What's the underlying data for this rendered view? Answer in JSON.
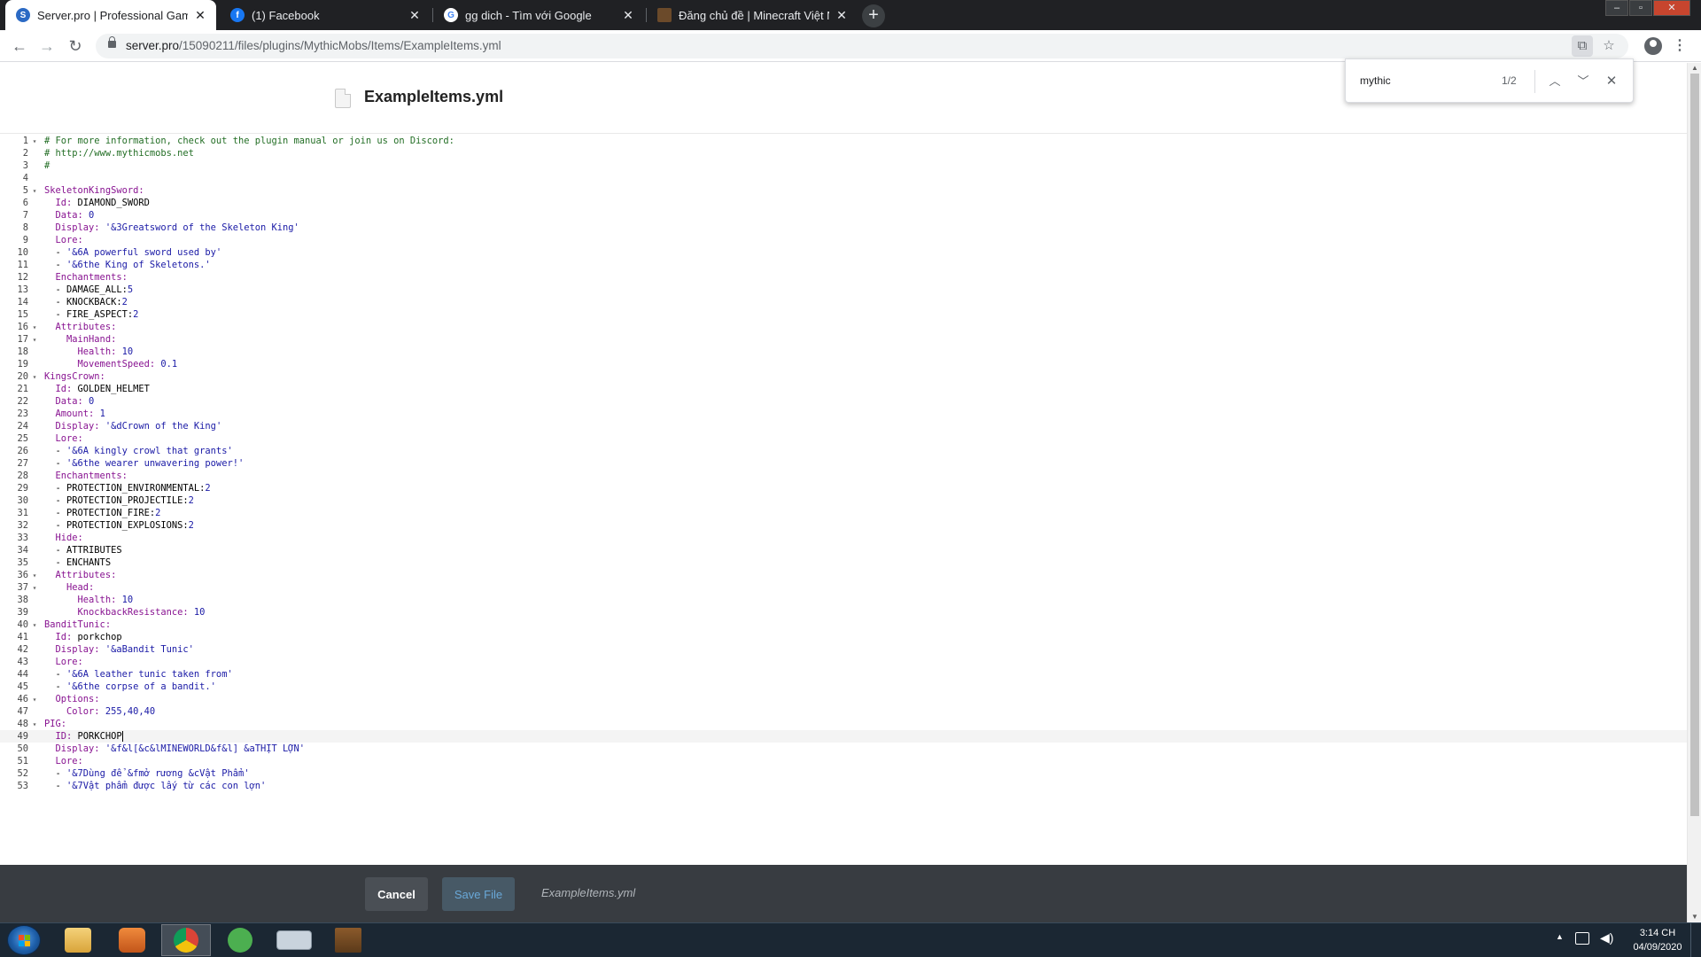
{
  "browser": {
    "tabs": [
      {
        "title": "Server.pro | Professional Game Se",
        "active": true,
        "favicon": "serverpro-icon"
      },
      {
        "title": "(1) Facebook",
        "active": false,
        "favicon": "facebook-icon"
      },
      {
        "title": "gg dich - Tìm với Google",
        "active": false,
        "favicon": "google-icon"
      },
      {
        "title": "Đăng chủ đề | Minecraft Việt Nam",
        "active": false,
        "favicon": "minecraft-icon"
      }
    ],
    "close_glyph": "✕",
    "new_tab_glyph": "+",
    "url_host": "server.pro",
    "url_path": "/15090211/files/plugins/MythicMobs/Items/ExampleItems.yml",
    "window_controls": [
      "–",
      "▫",
      "✕"
    ]
  },
  "find_bar": {
    "query": "mythic",
    "count": "1/2"
  },
  "file": {
    "title": "ExampleItems.yml"
  },
  "editor": {
    "current_line": 49,
    "lines": [
      {
        "n": "1",
        "fold": true,
        "parts": [
          {
            "t": "com",
            "s": "# For more information, check out the plugin manual or join us on Discord:"
          }
        ]
      },
      {
        "n": "2",
        "fold": false,
        "parts": [
          {
            "t": "com",
            "s": "# http://www.mythicmobs.net"
          }
        ]
      },
      {
        "n": "3",
        "fold": false,
        "parts": [
          {
            "t": "com",
            "s": "#"
          }
        ]
      },
      {
        "n": "4",
        "fold": false,
        "parts": []
      },
      {
        "n": "5",
        "fold": true,
        "parts": [
          {
            "t": "key",
            "s": "SkeletonKingSword:"
          }
        ]
      },
      {
        "n": "6",
        "fold": false,
        "parts": [
          {
            "t": "key",
            "s": "  Id: "
          },
          {
            "t": "plain",
            "s": "DIAMOND_SWORD"
          }
        ]
      },
      {
        "n": "7",
        "fold": false,
        "parts": [
          {
            "t": "key",
            "s": "  Data: "
          },
          {
            "t": "num",
            "s": "0"
          }
        ]
      },
      {
        "n": "8",
        "fold": false,
        "parts": [
          {
            "t": "key",
            "s": "  Display: "
          },
          {
            "t": "str",
            "s": "'&3Greatsword of the Skeleton King'"
          }
        ]
      },
      {
        "n": "9",
        "fold": false,
        "parts": [
          {
            "t": "key",
            "s": "  Lore:"
          }
        ]
      },
      {
        "n": "10",
        "fold": false,
        "parts": [
          {
            "t": "plain",
            "s": "  - "
          },
          {
            "t": "str",
            "s": "'&6A powerful sword used by'"
          }
        ]
      },
      {
        "n": "11",
        "fold": false,
        "parts": [
          {
            "t": "plain",
            "s": "  - "
          },
          {
            "t": "str",
            "s": "'&6the King of Skeletons.'"
          }
        ]
      },
      {
        "n": "12",
        "fold": false,
        "parts": [
          {
            "t": "key",
            "s": "  Enchantments:"
          }
        ]
      },
      {
        "n": "13",
        "fold": false,
        "parts": [
          {
            "t": "plain",
            "s": "  - DAMAGE_ALL:"
          },
          {
            "t": "num",
            "s": "5"
          }
        ]
      },
      {
        "n": "14",
        "fold": false,
        "parts": [
          {
            "t": "plain",
            "s": "  - KNOCKBACK:"
          },
          {
            "t": "num",
            "s": "2"
          }
        ]
      },
      {
        "n": "15",
        "fold": false,
        "parts": [
          {
            "t": "plain",
            "s": "  - FIRE_ASPECT:"
          },
          {
            "t": "num",
            "s": "2"
          }
        ]
      },
      {
        "n": "16",
        "fold": true,
        "parts": [
          {
            "t": "key",
            "s": "  Attributes:"
          }
        ]
      },
      {
        "n": "17",
        "fold": true,
        "parts": [
          {
            "t": "key",
            "s": "    MainHand:"
          }
        ]
      },
      {
        "n": "18",
        "fold": false,
        "parts": [
          {
            "t": "key",
            "s": "      Health: "
          },
          {
            "t": "num",
            "s": "10"
          }
        ]
      },
      {
        "n": "19",
        "fold": false,
        "parts": [
          {
            "t": "key",
            "s": "      MovementSpeed: "
          },
          {
            "t": "num",
            "s": "0.1"
          }
        ]
      },
      {
        "n": "20",
        "fold": true,
        "parts": [
          {
            "t": "key",
            "s": "KingsCrown:"
          }
        ]
      },
      {
        "n": "21",
        "fold": false,
        "parts": [
          {
            "t": "key",
            "s": "  Id: "
          },
          {
            "t": "plain",
            "s": "GOLDEN_HELMET"
          }
        ]
      },
      {
        "n": "22",
        "fold": false,
        "parts": [
          {
            "t": "key",
            "s": "  Data: "
          },
          {
            "t": "num",
            "s": "0"
          }
        ]
      },
      {
        "n": "23",
        "fold": false,
        "parts": [
          {
            "t": "key",
            "s": "  Amount: "
          },
          {
            "t": "num",
            "s": "1"
          }
        ]
      },
      {
        "n": "24",
        "fold": false,
        "parts": [
          {
            "t": "key",
            "s": "  Display: "
          },
          {
            "t": "str",
            "s": "'&dCrown of the King'"
          }
        ]
      },
      {
        "n": "25",
        "fold": false,
        "parts": [
          {
            "t": "key",
            "s": "  Lore:"
          }
        ]
      },
      {
        "n": "26",
        "fold": false,
        "parts": [
          {
            "t": "plain",
            "s": "  - "
          },
          {
            "t": "str",
            "s": "'&6A kingly crowl that grants'"
          }
        ]
      },
      {
        "n": "27",
        "fold": false,
        "parts": [
          {
            "t": "plain",
            "s": "  - "
          },
          {
            "t": "str",
            "s": "'&6the wearer unwavering power!'"
          }
        ]
      },
      {
        "n": "28",
        "fold": false,
        "parts": [
          {
            "t": "key",
            "s": "  Enchantments:"
          }
        ]
      },
      {
        "n": "29",
        "fold": false,
        "parts": [
          {
            "t": "plain",
            "s": "  - PROTECTION_ENVIRONMENTAL:"
          },
          {
            "t": "num",
            "s": "2"
          }
        ]
      },
      {
        "n": "30",
        "fold": false,
        "parts": [
          {
            "t": "plain",
            "s": "  - PROTECTION_PROJECTILE:"
          },
          {
            "t": "num",
            "s": "2"
          }
        ]
      },
      {
        "n": "31",
        "fold": false,
        "parts": [
          {
            "t": "plain",
            "s": "  - PROTECTION_FIRE:"
          },
          {
            "t": "num",
            "s": "2"
          }
        ]
      },
      {
        "n": "32",
        "fold": false,
        "parts": [
          {
            "t": "plain",
            "s": "  - PROTECTION_EXPLOSIONS:"
          },
          {
            "t": "num",
            "s": "2"
          }
        ]
      },
      {
        "n": "33",
        "fold": false,
        "parts": [
          {
            "t": "key",
            "s": "  Hide:"
          }
        ]
      },
      {
        "n": "34",
        "fold": false,
        "parts": [
          {
            "t": "plain",
            "s": "  - ATTRIBUTES"
          }
        ]
      },
      {
        "n": "35",
        "fold": false,
        "parts": [
          {
            "t": "plain",
            "s": "  - ENCHANTS"
          }
        ]
      },
      {
        "n": "36",
        "fold": true,
        "parts": [
          {
            "t": "key",
            "s": "  Attributes:"
          }
        ]
      },
      {
        "n": "37",
        "fold": true,
        "parts": [
          {
            "t": "key",
            "s": "    Head:"
          }
        ]
      },
      {
        "n": "38",
        "fold": false,
        "parts": [
          {
            "t": "key",
            "s": "      Health: "
          },
          {
            "t": "num",
            "s": "10"
          }
        ]
      },
      {
        "n": "39",
        "fold": false,
        "parts": [
          {
            "t": "key",
            "s": "      KnockbackResistance: "
          },
          {
            "t": "num",
            "s": "10"
          }
        ]
      },
      {
        "n": "40",
        "fold": true,
        "parts": [
          {
            "t": "key",
            "s": "BanditTunic:"
          }
        ]
      },
      {
        "n": "41",
        "fold": false,
        "parts": [
          {
            "t": "key",
            "s": "  Id: "
          },
          {
            "t": "plain",
            "s": "porkchop"
          }
        ]
      },
      {
        "n": "42",
        "fold": false,
        "parts": [
          {
            "t": "key",
            "s": "  Display: "
          },
          {
            "t": "str",
            "s": "'&aBandit Tunic'"
          }
        ]
      },
      {
        "n": "43",
        "fold": false,
        "parts": [
          {
            "t": "key",
            "s": "  Lore:"
          }
        ]
      },
      {
        "n": "44",
        "fold": false,
        "parts": [
          {
            "t": "plain",
            "s": "  - "
          },
          {
            "t": "str",
            "s": "'&6A leather tunic taken from'"
          }
        ]
      },
      {
        "n": "45",
        "fold": false,
        "parts": [
          {
            "t": "plain",
            "s": "  - "
          },
          {
            "t": "str",
            "s": "'&6the corpse of a bandit.'"
          }
        ]
      },
      {
        "n": "46",
        "fold": true,
        "parts": [
          {
            "t": "key",
            "s": "  Options:"
          }
        ]
      },
      {
        "n": "47",
        "fold": false,
        "parts": [
          {
            "t": "key",
            "s": "    Color: "
          },
          {
            "t": "num",
            "s": "255,40,40"
          }
        ]
      },
      {
        "n": "48",
        "fold": true,
        "parts": [
          {
            "t": "key",
            "s": "PIG:"
          }
        ]
      },
      {
        "n": "49",
        "fold": false,
        "parts": [
          {
            "t": "key",
            "s": "  ID: "
          },
          {
            "t": "plain",
            "s": "PORKCHOP"
          }
        ]
      },
      {
        "n": "50",
        "fold": false,
        "parts": [
          {
            "t": "key",
            "s": "  Display: "
          },
          {
            "t": "str",
            "s": "'&f&l[&c&lMINEWORLD&f&l] &aTHỊT LỢN'"
          }
        ]
      },
      {
        "n": "51",
        "fold": false,
        "parts": [
          {
            "t": "key",
            "s": "  Lore:"
          }
        ]
      },
      {
        "n": "52",
        "fold": false,
        "parts": [
          {
            "t": "plain",
            "s": "  - "
          },
          {
            "t": "str",
            "s": "'&7Dùng để &fmở rương &cVật Phẩm'"
          }
        ]
      },
      {
        "n": "53",
        "fold": false,
        "parts": [
          {
            "t": "plain",
            "s": "  - "
          },
          {
            "t": "str",
            "s": "'&7Vật phẩm được lấy từ các con lợn'"
          }
        ]
      }
    ]
  },
  "actions": {
    "cancel_label": "Cancel",
    "save_label": "Save File",
    "filename": "ExampleItems.yml"
  },
  "taskbar": {
    "apps": [
      "windows-explorer-icon",
      "media-player-icon",
      "chrome-icon",
      "greenshot-icon",
      "on-screen-keyboard-icon",
      "minecraft-icon"
    ],
    "time": "3:14 CH",
    "date": "04/09/2020"
  },
  "colors": {
    "key": "#881391",
    "string": "#1a1aa6",
    "comment": "#236e25",
    "action_bar": "#383c41",
    "save_text": "#69a8d8"
  }
}
